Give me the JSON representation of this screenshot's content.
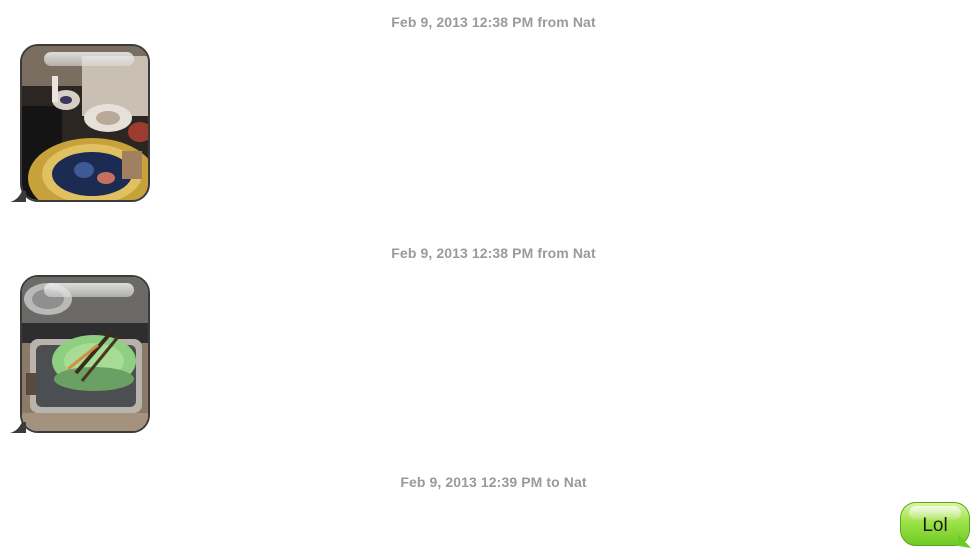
{
  "conversation": {
    "messages": [
      {
        "timestamp": "Feb 9, 2013 12:38 PM from Nat",
        "direction": "incoming",
        "type": "photo",
        "photo_subject": "table with dishes and a yellow bowl"
      },
      {
        "timestamp": "Feb 9, 2013 12:38 PM from Nat",
        "direction": "incoming",
        "type": "photo",
        "photo_subject": "sink with green plates and utensils"
      },
      {
        "timestamp": "Feb 9, 2013 12:39 PM to Nat",
        "direction": "outgoing",
        "type": "text",
        "text": "Lol"
      }
    ]
  },
  "colors": {
    "timestamp_text": "#9a9a9a",
    "sent_bubble": "#9ee24a",
    "photo_border": "#3b3b3b"
  }
}
